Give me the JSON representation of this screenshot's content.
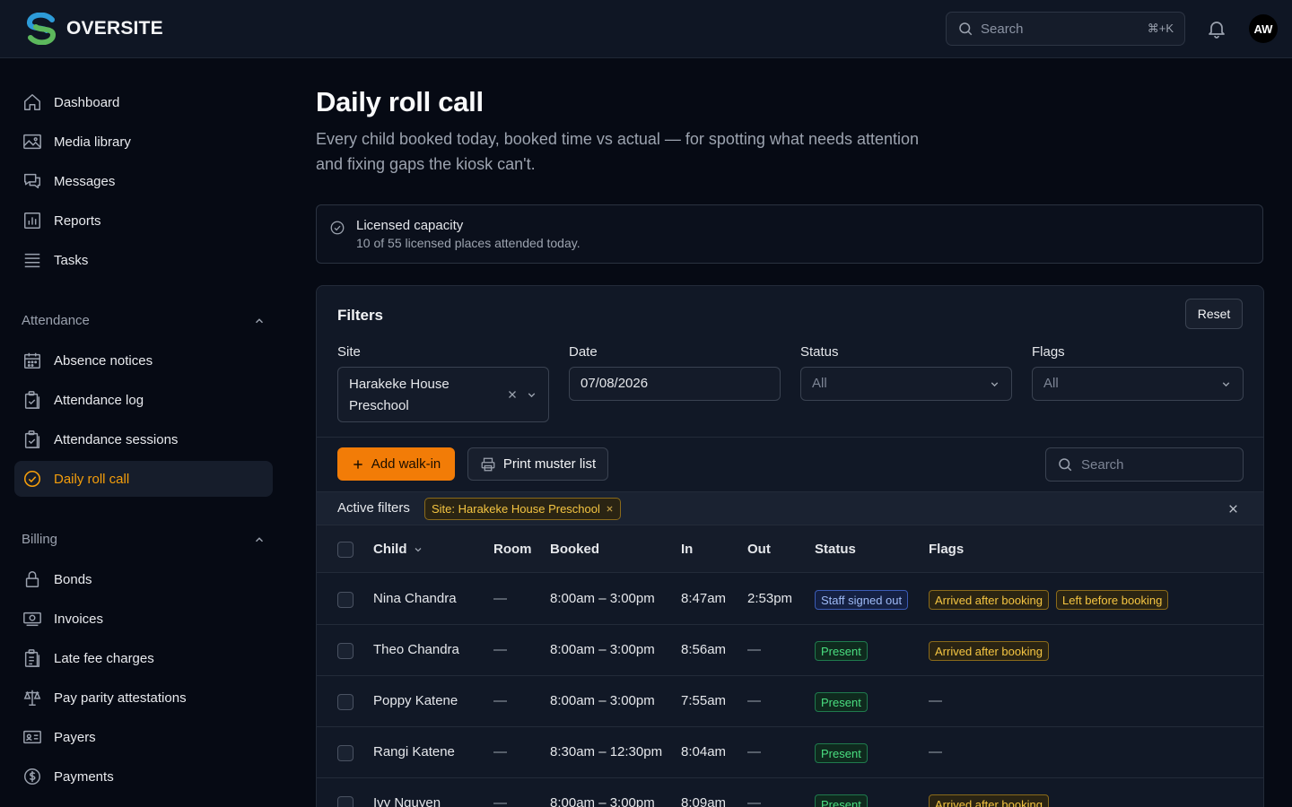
{
  "app": {
    "name": "OVERSITE",
    "search_placeholder": "Search",
    "search_shortcut": "⌘+K",
    "user_initials": "AW"
  },
  "sidebar": {
    "main_items": [
      {
        "label": "Dashboard",
        "icon": "home-icon"
      },
      {
        "label": "Media library",
        "icon": "image-icon"
      },
      {
        "label": "Messages",
        "icon": "chat-icon"
      },
      {
        "label": "Reports",
        "icon": "chart-icon"
      },
      {
        "label": "Tasks",
        "icon": "list-icon"
      }
    ],
    "attendance": {
      "heading": "Attendance",
      "items": [
        {
          "label": "Absence notices",
          "icon": "calendar-icon"
        },
        {
          "label": "Attendance log",
          "icon": "clipboard-check-icon"
        },
        {
          "label": "Attendance sessions",
          "icon": "clipboard-check-icon"
        },
        {
          "label": "Daily roll call",
          "icon": "check-circle-icon",
          "active": true
        }
      ]
    },
    "billing": {
      "heading": "Billing",
      "items": [
        {
          "label": "Bonds",
          "icon": "lock-icon"
        },
        {
          "label": "Invoices",
          "icon": "banknote-icon"
        },
        {
          "label": "Late fee charges",
          "icon": "clipboard-list-icon"
        },
        {
          "label": "Pay parity attestations",
          "icon": "scale-icon"
        },
        {
          "label": "Payers",
          "icon": "id-card-icon"
        },
        {
          "label": "Payments",
          "icon": "dollar-circle-icon"
        }
      ]
    }
  },
  "page": {
    "title": "Daily roll call",
    "subtitle": "Every child booked today, booked time vs actual — for spotting what needs attention and fixing gaps the kiosk can't."
  },
  "capacity": {
    "title": "Licensed capacity",
    "text": "10 of 55 licensed places attended today."
  },
  "filters": {
    "title": "Filters",
    "reset_label": "Reset",
    "site": {
      "label": "Site",
      "value": "Harakeke House Preschool"
    },
    "date": {
      "label": "Date",
      "value": "07/08/2026"
    },
    "status": {
      "label": "Status",
      "placeholder": "All"
    },
    "flags": {
      "label": "Flags",
      "placeholder": "All"
    }
  },
  "toolbar": {
    "add_label": "Add walk-in",
    "print_label": "Print muster list",
    "search_placeholder": "Search"
  },
  "active_filters": {
    "label": "Active filters",
    "chip": "Site: Harakeke House Preschool"
  },
  "table": {
    "columns": [
      "Child",
      "Room",
      "Booked",
      "In",
      "Out",
      "Status",
      "Flags"
    ],
    "rows": [
      {
        "child": "Nina Chandra",
        "room": "—",
        "booked": "8:00am – 3:00pm",
        "in": "8:47am",
        "out": "2:53pm",
        "status": "Staff signed out",
        "status_tone": "blue",
        "flags": [
          "Arrived after booking",
          "Left before booking"
        ]
      },
      {
        "child": "Theo Chandra",
        "room": "—",
        "booked": "8:00am – 3:00pm",
        "in": "8:56am",
        "out": "—",
        "status": "Present",
        "status_tone": "green",
        "flags": [
          "Arrived after booking"
        ]
      },
      {
        "child": "Poppy Katene",
        "room": "—",
        "booked": "8:00am – 3:00pm",
        "in": "7:55am",
        "out": "—",
        "status": "Present",
        "status_tone": "green",
        "flags": []
      },
      {
        "child": "Rangi Katene",
        "room": "—",
        "booked": "8:30am – 12:30pm",
        "in": "8:04am",
        "out": "—",
        "status": "Present",
        "status_tone": "green",
        "flags": []
      },
      {
        "child": "Ivy Nguyen",
        "room": "—",
        "booked": "8:00am – 3:00pm",
        "in": "8:09am",
        "out": "—",
        "status": "Present",
        "status_tone": "green",
        "flags": [
          "Arrived after booking"
        ]
      }
    ],
    "empty_flag": "—"
  },
  "colors": {
    "accent": "#f59e0b",
    "primary_button": "#f27c07",
    "background": "#060a14"
  }
}
